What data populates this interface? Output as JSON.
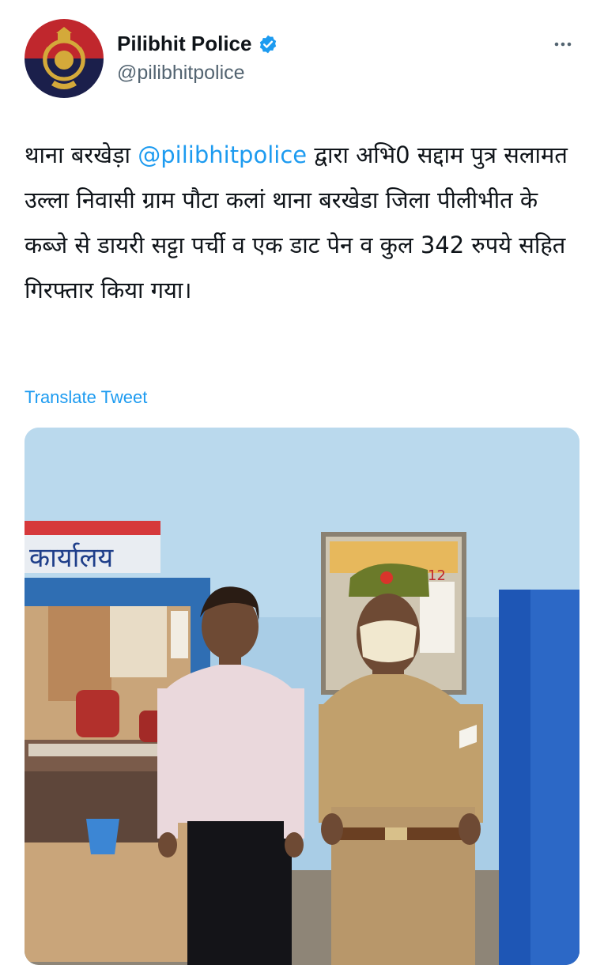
{
  "account": {
    "display_name": "Pilibhit Police",
    "handle": "@pilibhitpolice",
    "verified": true,
    "avatar_icon": "up-police-emblem-icon"
  },
  "tweet": {
    "text_before_mention": "थाना बरखेड़ा ",
    "mention": "@pilibhitpolice",
    "text_after_mention": " द्वारा अभि0 सद्दाम पुत्र सलामत उल्ला निवासी ग्राम पौटा कलां थाना बरखेडा जिला पीलीभीत के कब्जे से डायरी सट्टा पर्ची व एक डाट पेन व कुल 342 रुपये सहित गिरफ्तार किया गया।",
    "translate_label": "Translate Tweet"
  },
  "media": {
    "sign_text": "कार्यालय",
    "calendar_number": "12"
  },
  "colors": {
    "link": "#1d9bf0",
    "secondary_text": "#536471",
    "avatar_red": "#c0272d",
    "avatar_navy": "#1b1f4b"
  }
}
